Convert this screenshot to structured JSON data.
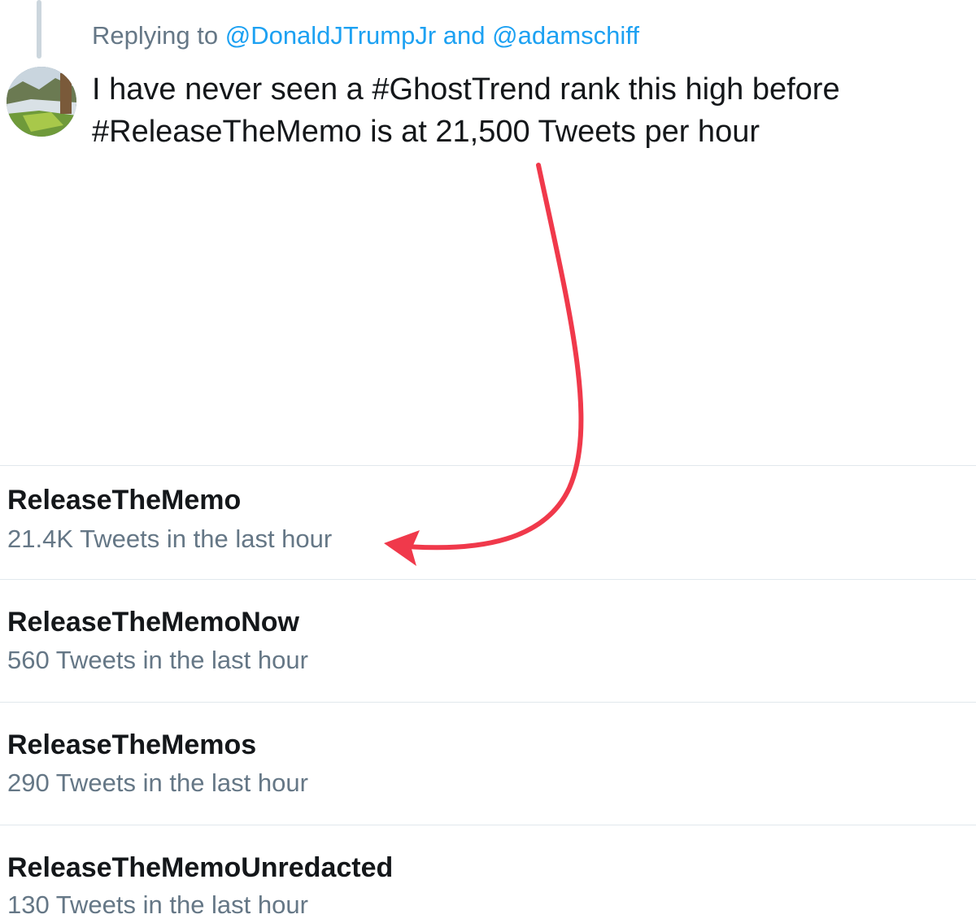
{
  "reply": {
    "prefix": "Replying to",
    "mention1": "@DonaldJTrumpJr",
    "conjunction": "and",
    "mention2": "@adamschiff"
  },
  "tweet": {
    "line1": "I have never seen a #GhostTrend rank this high before",
    "line2": "#ReleaseTheMemo is at 21,500 Tweets per hour"
  },
  "trends": [
    {
      "name": "ReleaseTheMemo",
      "count": "21.4K Tweets in the last hour"
    },
    {
      "name": "ReleaseTheMemoNow",
      "count": "560 Tweets in the last hour"
    },
    {
      "name": "ReleaseTheMemos",
      "count": "290 Tweets in the last hour"
    },
    {
      "name": "ReleaseTheMemoUnredacted",
      "count": "130 Tweets in the last hour"
    }
  ],
  "colors": {
    "mention": "#1da1f2",
    "secondary_text": "#657786",
    "annotation_arrow": "#f0394b"
  },
  "icons": {
    "avatar": "profile-photo",
    "annotation": "curved-red-arrow"
  }
}
